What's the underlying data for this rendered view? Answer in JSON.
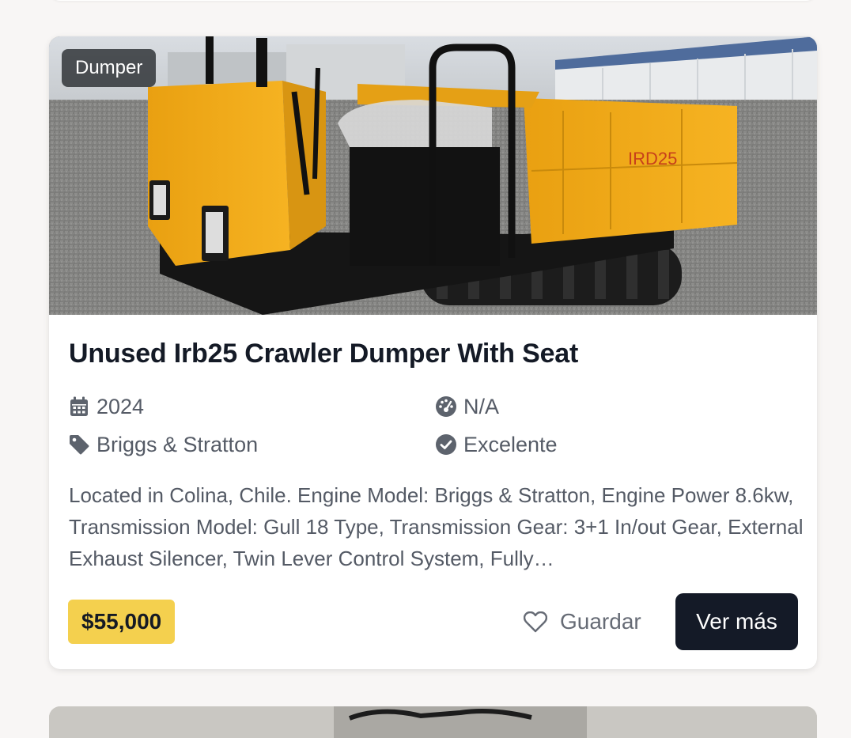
{
  "listing": {
    "category_badge": "Dumper",
    "title": "Unused Irb25 Crawler Dumper With Seat",
    "image_marking": "IRD25",
    "specs": {
      "year": {
        "icon": "calendar-icon",
        "value": "2024"
      },
      "hours": {
        "icon": "gauge-icon",
        "value": "N/A"
      },
      "brand": {
        "icon": "tag-icon",
        "value": "Briggs & Stratton"
      },
      "condition": {
        "icon": "check-circle-icon",
        "value": "Excelente"
      }
    },
    "description": "Located in Colina, Chile. Engine Model: Briggs & Stratton, Engine Power 8.6kw, Transmission Model: Gull 18 Type, Transmission Gear: 3+1 In/out Gear, External Exhaust Silencer, Twin Lever Control System, Fully…",
    "price": "$55,000",
    "save_label": "Guardar",
    "more_label": "Ver más"
  },
  "colors": {
    "accent_price": "#f4d04e",
    "primary_button": "#141a27",
    "machine_yellow": "#f3a917"
  }
}
